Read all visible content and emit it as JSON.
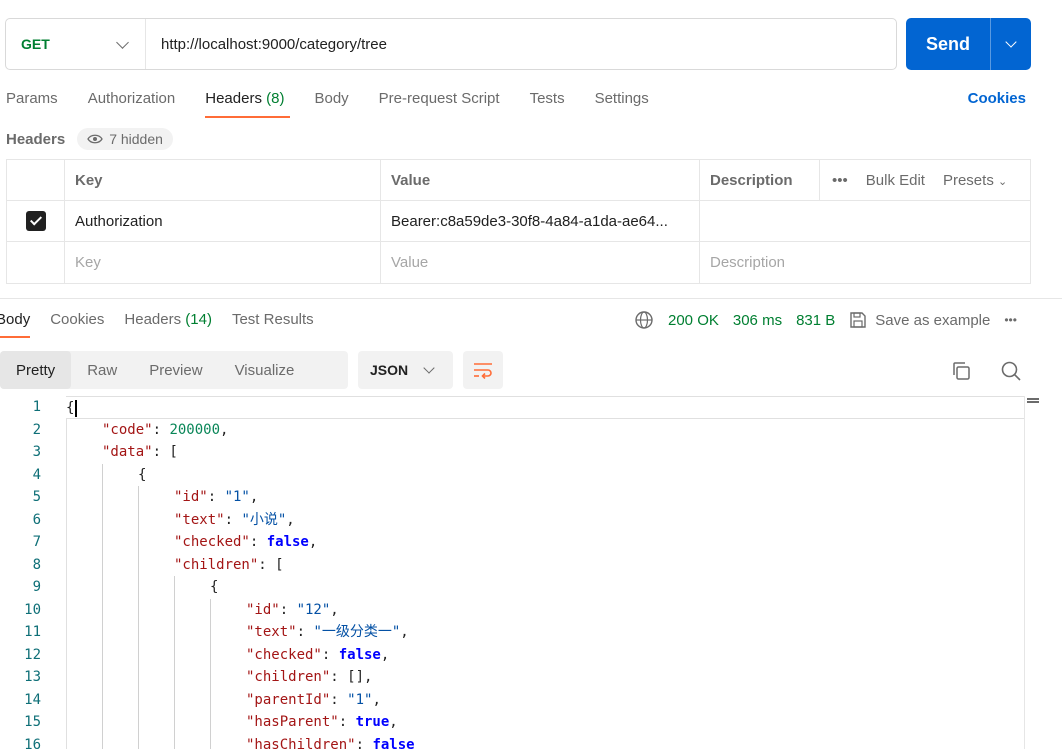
{
  "request": {
    "method": "GET",
    "url": "http://localhost:9000/category/tree",
    "send_label": "Send"
  },
  "request_tabs": [
    {
      "label": "Params"
    },
    {
      "label": "Authorization"
    },
    {
      "label": "Headers",
      "count": "(8)"
    },
    {
      "label": "Body"
    },
    {
      "label": "Pre-request Script"
    },
    {
      "label": "Tests"
    },
    {
      "label": "Settings"
    }
  ],
  "cookies_link": "Cookies",
  "headers_section": {
    "title": "Headers",
    "hidden_label": "7 hidden",
    "columns": {
      "key": "Key",
      "value": "Value",
      "description": "Description"
    },
    "bulk_edit": "Bulk Edit",
    "presets": "Presets",
    "rows": [
      {
        "checked": true,
        "key": "Authorization",
        "value": "Bearer:c8a59de3-30f8-4a84-a1da-ae64...",
        "description": ""
      }
    ],
    "placeholders": {
      "key": "Key",
      "value": "Value",
      "description": "Description"
    }
  },
  "response_tabs": [
    {
      "label": "Body"
    },
    {
      "label": "Cookies"
    },
    {
      "label": "Headers",
      "count": "(14)"
    },
    {
      "label": "Test Results"
    }
  ],
  "response_status": {
    "status": "200 OK",
    "time": "306 ms",
    "size": "831 B",
    "save_label": "Save as example"
  },
  "format_tabs": [
    "Pretty",
    "Raw",
    "Preview",
    "Visualize"
  ],
  "language": "JSON",
  "code_lines": [
    {
      "n": "1",
      "indent": 0,
      "parts": [
        [
          "pun",
          "{"
        ]
      ]
    },
    {
      "n": "2",
      "indent": 1,
      "parts": [
        [
          "key",
          "\"code\""
        ],
        [
          "pun",
          ": "
        ],
        [
          "num",
          "200000"
        ],
        [
          "pun",
          ","
        ]
      ]
    },
    {
      "n": "3",
      "indent": 1,
      "parts": [
        [
          "key",
          "\"data\""
        ],
        [
          "pun",
          ": ["
        ]
      ]
    },
    {
      "n": "4",
      "indent": 2,
      "parts": [
        [
          "pun",
          "{"
        ]
      ]
    },
    {
      "n": "5",
      "indent": 3,
      "parts": [
        [
          "key",
          "\"id\""
        ],
        [
          "pun",
          ": "
        ],
        [
          "str",
          "\"1\""
        ],
        [
          "pun",
          ","
        ]
      ]
    },
    {
      "n": "6",
      "indent": 3,
      "parts": [
        [
          "key",
          "\"text\""
        ],
        [
          "pun",
          ": "
        ],
        [
          "str",
          "\"小说\""
        ],
        [
          "pun",
          ","
        ]
      ]
    },
    {
      "n": "7",
      "indent": 3,
      "parts": [
        [
          "key",
          "\"checked\""
        ],
        [
          "pun",
          ": "
        ],
        [
          "kw",
          "false"
        ],
        [
          "pun",
          ","
        ]
      ]
    },
    {
      "n": "8",
      "indent": 3,
      "parts": [
        [
          "key",
          "\"children\""
        ],
        [
          "pun",
          ": ["
        ]
      ]
    },
    {
      "n": "9",
      "indent": 4,
      "parts": [
        [
          "pun",
          "{"
        ]
      ]
    },
    {
      "n": "10",
      "indent": 5,
      "parts": [
        [
          "key",
          "\"id\""
        ],
        [
          "pun",
          ": "
        ],
        [
          "str",
          "\"12\""
        ],
        [
          "pun",
          ","
        ]
      ]
    },
    {
      "n": "11",
      "indent": 5,
      "parts": [
        [
          "key",
          "\"text\""
        ],
        [
          "pun",
          ": "
        ],
        [
          "str",
          "\"一级分类一\""
        ],
        [
          "pun",
          ","
        ]
      ]
    },
    {
      "n": "12",
      "indent": 5,
      "parts": [
        [
          "key",
          "\"checked\""
        ],
        [
          "pun",
          ": "
        ],
        [
          "kw",
          "false"
        ],
        [
          "pun",
          ","
        ]
      ]
    },
    {
      "n": "13",
      "indent": 5,
      "parts": [
        [
          "key",
          "\"children\""
        ],
        [
          "pun",
          ": [],"
        ]
      ]
    },
    {
      "n": "14",
      "indent": 5,
      "parts": [
        [
          "key",
          "\"parentId\""
        ],
        [
          "pun",
          ": "
        ],
        [
          "str",
          "\"1\""
        ],
        [
          "pun",
          ","
        ]
      ]
    },
    {
      "n": "15",
      "indent": 5,
      "parts": [
        [
          "key",
          "\"hasParent\""
        ],
        [
          "pun",
          ": "
        ],
        [
          "kw",
          "true"
        ],
        [
          "pun",
          ","
        ]
      ]
    },
    {
      "n": "16",
      "indent": 5,
      "parts": [
        [
          "key",
          "\"hasChildren\""
        ],
        [
          "pun",
          ": "
        ],
        [
          "kw",
          "false"
        ]
      ]
    }
  ],
  "colors": {
    "accent": "#ff6c37",
    "send_button": "#0265d2",
    "method_get": "#007f31",
    "status_ok": "#007f31",
    "json_key": "#a31515",
    "json_string": "#0451a5",
    "json_number": "#098658",
    "json_keyword": "#0000ff"
  }
}
